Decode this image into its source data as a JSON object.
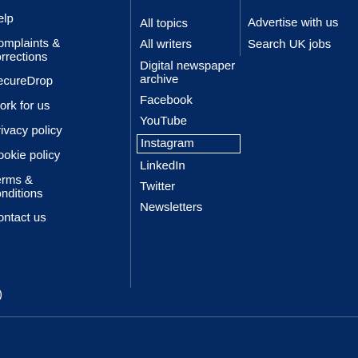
{
  "header": {
    "left_fragment": "",
    "right_fragment": ""
  },
  "col1": {
    "items": [
      {
        "label": "Help"
      },
      {
        "label": "Complaints & corrections"
      },
      {
        "label": "SecureDrop"
      },
      {
        "label": "Work for us"
      },
      {
        "label": "Privacy policy"
      },
      {
        "label": "Cookie policy"
      },
      {
        "label": "Terms & conditions"
      },
      {
        "label": "Contact us"
      }
    ]
  },
  "col2": {
    "items": [
      {
        "label": "All topics"
      },
      {
        "label": "All writers"
      },
      {
        "label": "Digital newspaper archive"
      },
      {
        "label": "Facebook"
      },
      {
        "label": "YouTube"
      },
      {
        "label": "Instagram"
      },
      {
        "label": "LinkedIn"
      },
      {
        "label": "Twitter"
      },
      {
        "label": "Newsletters"
      }
    ]
  },
  "col3": {
    "items": [
      {
        "label": "Advertise with us"
      },
      {
        "label": "Search UK jobs"
      }
    ]
  },
  "footer": {
    "fragment": ")"
  },
  "colors": {
    "background": "#052962",
    "text": "#ffffff",
    "divider": "#506991"
  }
}
